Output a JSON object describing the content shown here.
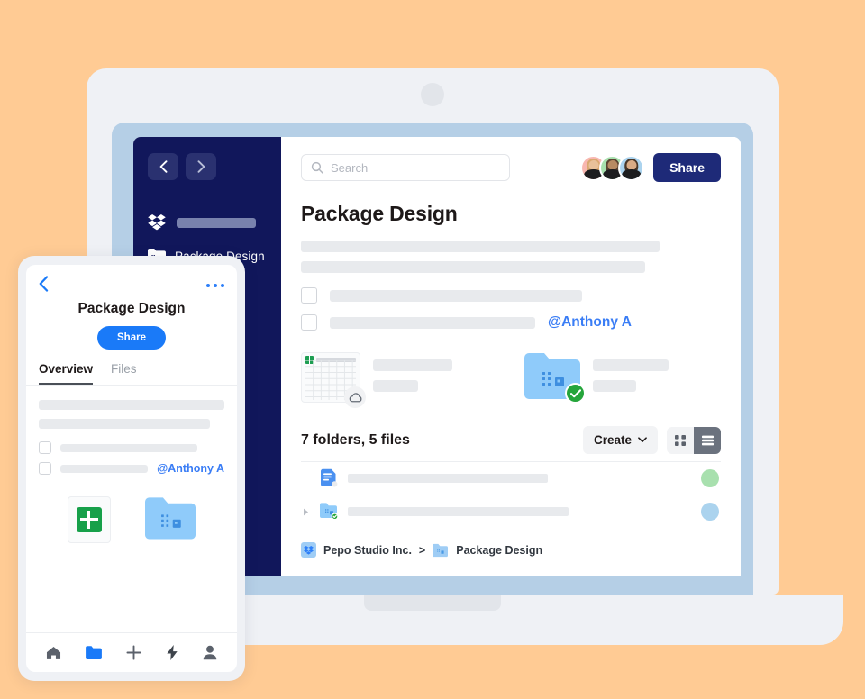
{
  "background_color": "#ffcb94",
  "desktop": {
    "sidebar": {
      "back_icon": "chevron-left-icon",
      "forward_icon": "chevron-right-icon",
      "brand_icon": "dropbox-logo-icon",
      "items": [
        {
          "label": "Package Design",
          "icon": "folder-company-icon"
        }
      ]
    },
    "search": {
      "placeholder": "Search",
      "icon": "search-icon",
      "value": ""
    },
    "share_label": "Share",
    "page_title": "Package Design",
    "mention": "@Anthony A",
    "previews": [
      {
        "icon": "spreadsheet-thumbnail",
        "badge": "cloud-icon"
      },
      {
        "icon": "folder-company-icon",
        "badge": "check-circle-icon"
      }
    ],
    "files_count": "7 folders, 5 files",
    "create_label": "Create",
    "create_chevron": "chevron-down-icon",
    "view_grid_icon": "grid-view-icon",
    "view_list_icon": "list-view-icon",
    "view_active": "list",
    "rows": [
      {
        "icon": "paper-doc-icon",
        "badge": "dot-badge",
        "has_disclosure": false
      },
      {
        "icon": "folder-company-icon",
        "badge": "check-circle-icon",
        "has_disclosure": true
      }
    ],
    "breadcrumb": {
      "root_icon": "dropbox-logo-icon",
      "root": "Pepo Studio Inc.",
      "separator": ">",
      "current_icon": "folder-company-icon",
      "current": "Package Design"
    }
  },
  "mobile": {
    "back_icon": "chevron-left-icon",
    "more_icon": "more-horizontal-icon",
    "title": "Package Design",
    "share_label": "Share",
    "tabs": [
      {
        "label": "Overview",
        "active": true
      },
      {
        "label": "Files",
        "active": false
      }
    ],
    "mention": "@Anthony A",
    "tiles": [
      {
        "icon": "spreadsheet-icon"
      },
      {
        "icon": "folder-company-icon"
      }
    ],
    "nav": [
      {
        "icon": "home-icon",
        "active": false
      },
      {
        "icon": "folder-icon",
        "active": true
      },
      {
        "icon": "plus-icon",
        "active": false
      },
      {
        "icon": "bolt-icon",
        "active": false
      },
      {
        "icon": "person-icon",
        "active": false
      }
    ]
  },
  "colors": {
    "accent_navy": "#11175b",
    "share_navy": "#1e2a78",
    "mention_blue": "#3a7df5",
    "mobile_blue": "#1a7af8",
    "folder_blue": "#8fcbfa",
    "green_check": "#25a53b",
    "background": "#ffcb94"
  }
}
